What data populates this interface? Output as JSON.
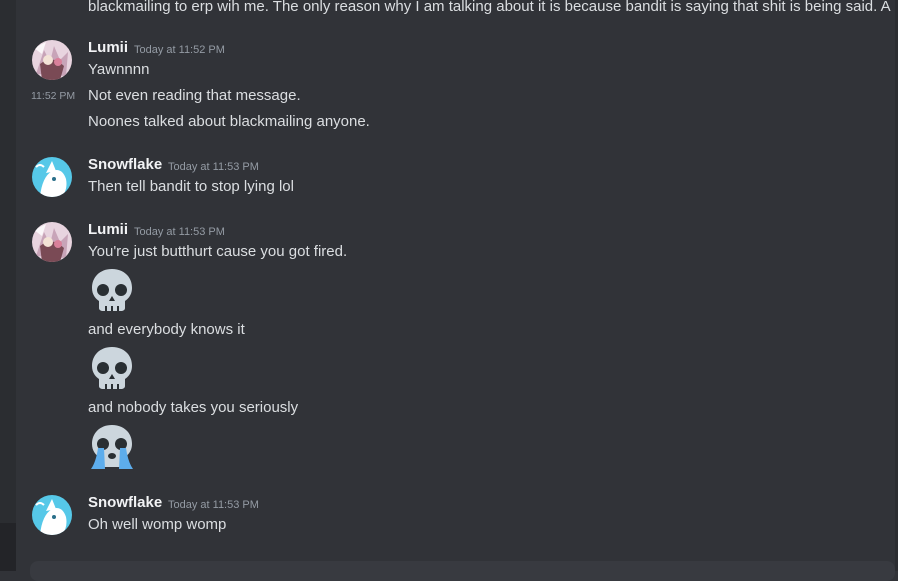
{
  "messages": {
    "truncated_text": "blackmailing to erp wih me. The only reason why I am talking about it is because bandit is saying that shit is being said. A",
    "g1": {
      "username": "Lumii",
      "timestamp": "Today at 11:52 PM",
      "line1": "Yawnnnn",
      "hover_time": "11:52 PM",
      "line2": "Not even reading that message.",
      "line3": "Noones talked about blackmailing anyone."
    },
    "g2": {
      "username": "Snowflake",
      "timestamp": "Today at 11:53 PM",
      "line1": "Then tell bandit to stop lying lol"
    },
    "g3": {
      "username": "Lumii",
      "timestamp": "Today at 11:53 PM",
      "line1": "You're just butthurt cause you got fired.",
      "emoji1": "skull-emoji",
      "line2": "and everybody knows it",
      "emoji2": "skull-emoji",
      "line3": "and nobody takes you seriously",
      "emoji3": "crying-skull-emoji"
    },
    "g4": {
      "username": "Snowflake",
      "timestamp": "Today at 11:53 PM",
      "line1": "Oh well womp womp"
    }
  },
  "colors": {
    "background": "#313338",
    "text": "#dbdee1",
    "username": "#f2f3f5",
    "timestamp": "#949ba4",
    "tear_blue": "#5dadec"
  }
}
